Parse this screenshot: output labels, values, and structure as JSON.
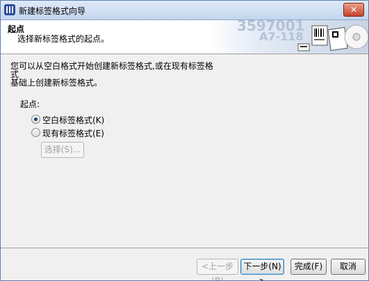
{
  "window": {
    "title": "新建标签格式向导",
    "close_label": "✕"
  },
  "header": {
    "title": "起点",
    "subtitle": "选择新标签格式的起点。",
    "art_text_1": "3597001",
    "art_text_2": "A7-118"
  },
  "body": {
    "description_line1": "您可以从空白格式开始创建新标签格式,或在现有标签格式",
    "description_line2": "基础上创建新标签格式。",
    "group_label": "起点:",
    "options": [
      {
        "label": "空白标签格式(K)",
        "selected": true
      },
      {
        "label": "现有标签格式(E)",
        "selected": false
      }
    ],
    "select_button": "选择(S)..."
  },
  "footer": {
    "back": "<上一步(B)",
    "next": "下一步(N) >",
    "finish": "完成(F)",
    "cancel": "取消"
  }
}
